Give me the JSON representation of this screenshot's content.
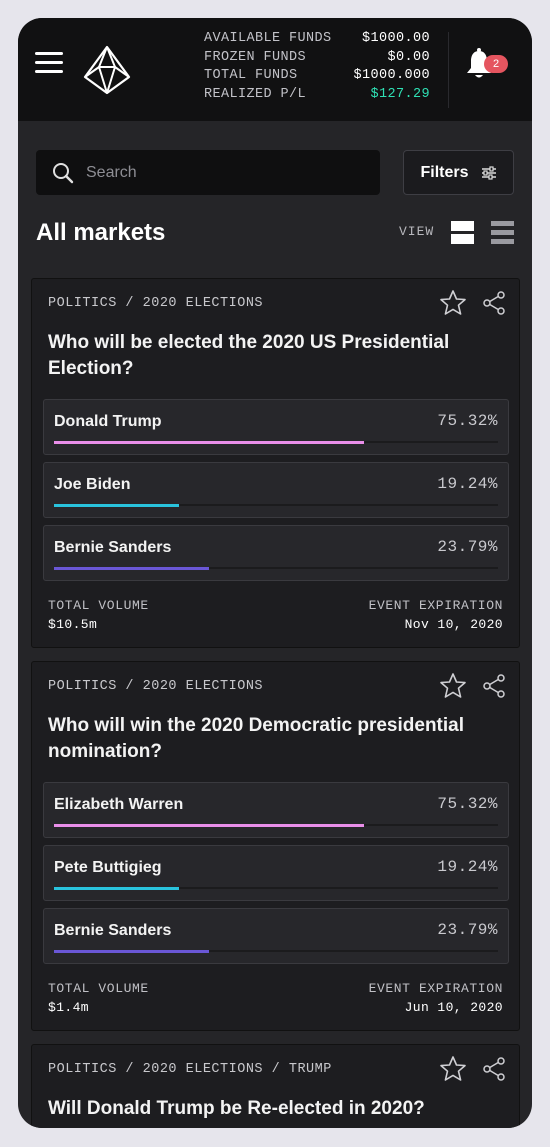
{
  "header": {
    "funds": [
      {
        "label": "AVAILABLE FUNDS",
        "value": "$1000.00"
      },
      {
        "label": "FROZEN FUNDS",
        "value": "$0.00"
      },
      {
        "label": "TOTAL FUNDS",
        "value": "$1000.000"
      },
      {
        "label": "REALIZED P/L",
        "value": "$127.29"
      }
    ],
    "notifications_count": "2"
  },
  "toolbar": {
    "search_placeholder": "Search",
    "filters_label": "Filters",
    "page_title": "All markets",
    "view_label": "VIEW"
  },
  "colors": {
    "positive": "#2fe0b4",
    "bar_pink": "#e98ee9",
    "bar_cyan": "#29c3dd",
    "bar_purple": "#6a57d6"
  },
  "markets": [
    {
      "category": "POLITICS / 2020 ELECTIONS",
      "question": "Who will be elected the 2020 US Presidential Election?",
      "outcomes": [
        {
          "name": "Donald Trump",
          "percent": "75.32%",
          "bar_fraction": 0.698
        },
        {
          "name": "Joe Biden",
          "percent": "19.24%",
          "bar_fraction": 0.282
        },
        {
          "name": "Bernie Sanders",
          "percent": "23.79%",
          "bar_fraction": 0.349
        }
      ],
      "volume_label": "TOTAL VOLUME",
      "volume_value": "$10.5m",
      "expiration_label": "EVENT EXPIRATION",
      "expiration_value": "Nov 10, 2020"
    },
    {
      "category": "POLITICS / 2020 ELECTIONS",
      "question": "Who will win the 2020 Democratic presidential nomination?",
      "outcomes": [
        {
          "name": "Elizabeth Warren",
          "percent": "75.32%",
          "bar_fraction": 0.698
        },
        {
          "name": "Pete Buttigieg",
          "percent": "19.24%",
          "bar_fraction": 0.282
        },
        {
          "name": "Bernie Sanders",
          "percent": "23.79%",
          "bar_fraction": 0.349
        }
      ],
      "volume_label": "TOTAL VOLUME",
      "volume_value": "$1.4m",
      "expiration_label": "EVENT EXPIRATION",
      "expiration_value": "Jun 10, 2020"
    },
    {
      "category": "POLITICS / 2020 ELECTIONS / TRUMP",
      "question": "Will Donald Trump be Re-elected in 2020?"
    }
  ]
}
